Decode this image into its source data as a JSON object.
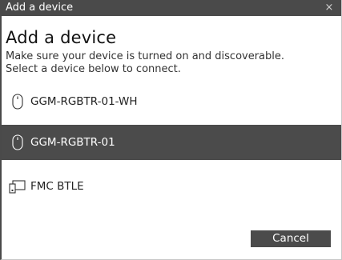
{
  "window": {
    "title": "Add a device",
    "close_glyph": "×"
  },
  "main": {
    "heading": "Add a device",
    "instruction_line1": "Make sure your device is turned on and discoverable.",
    "instruction_line2": "Select a device below to connect."
  },
  "devices": [
    {
      "name": "GGM-RGBTR-01-WH",
      "icon": "mouse-icon",
      "selected": false
    },
    {
      "name": "GGM-RGBTR-01",
      "icon": "mouse-icon",
      "selected": true
    },
    {
      "name": "FMC BTLE",
      "icon": "device-icon",
      "selected": false
    }
  ],
  "footer": {
    "cancel_label": "Cancel"
  },
  "colors": {
    "titlebar": "#4a4a4a",
    "selected_row": "#4b4b4b",
    "button": "#4b4b4b"
  }
}
